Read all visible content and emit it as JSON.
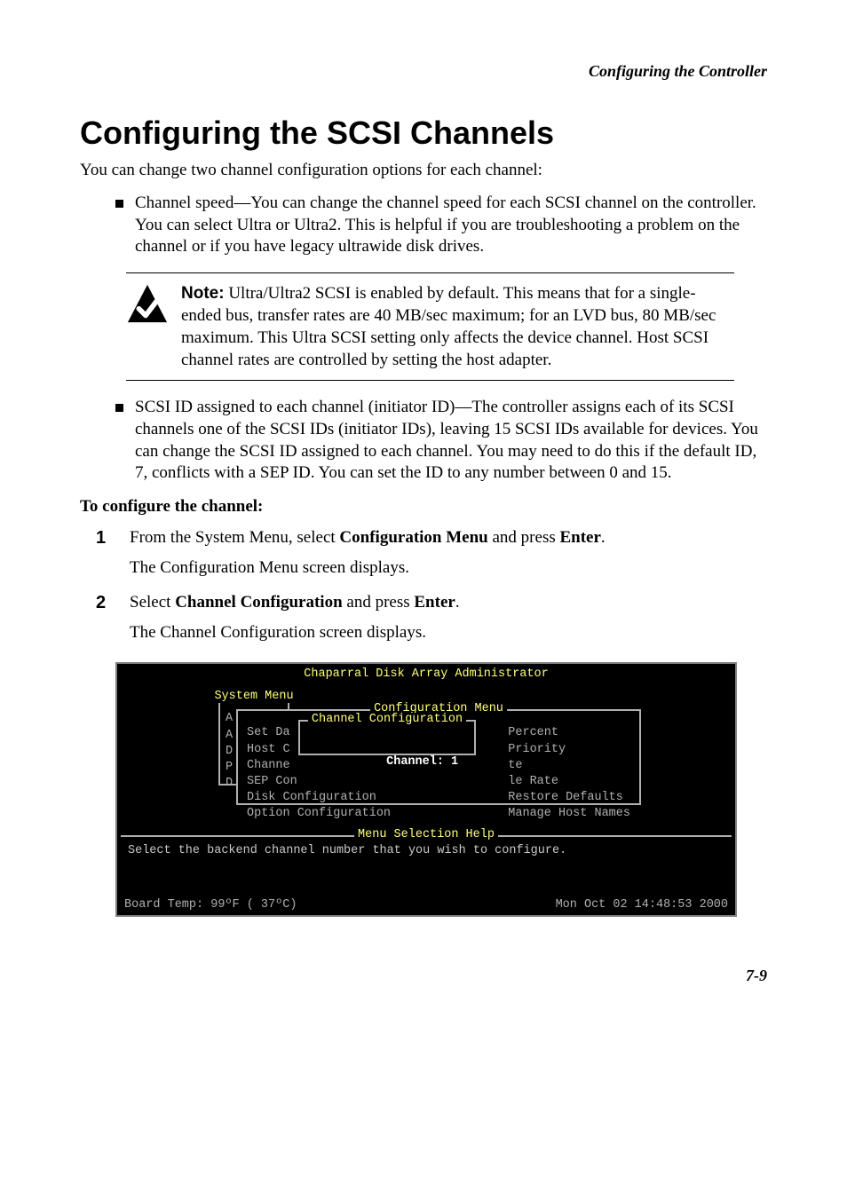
{
  "header": {
    "section_title": "Configuring the Controller"
  },
  "title": "Configuring the SCSI Channels",
  "intro": "You can change two channel configuration options for each channel:",
  "bullets": {
    "b1": "Channel speed—You can change the channel speed for each SCSI channel on the controller. You can select Ultra or Ultra2. This is helpful if you are troubleshooting a problem on the channel or if you have legacy ultrawide disk drives.",
    "b2": "SCSI ID assigned to each channel (initiator ID)—The controller assigns each of its SCSI channels one of the SCSI IDs (initiator IDs), leaving 15 SCSI IDs available for devices. You can change the SCSI ID assigned to each channel. You may need to do this if the default ID, 7, conflicts with a SEP ID. You can set the ID to any number between 0 and 15."
  },
  "note": {
    "label": "Note:",
    "text": " Ultra/Ultra2 SCSI is enabled by default. This means that for a single-ended bus, transfer rates are 40 MB/sec maximum; for an LVD bus, 80 MB/sec maximum. This Ultra SCSI setting only affects the device channel. Host SCSI channel rates are controlled by setting the host adapter."
  },
  "subhead": "To configure the channel:",
  "steps": {
    "s1": {
      "pre": "From the System Menu, select ",
      "bold1": "Configuration Menu",
      "mid": " and press ",
      "bold2": "Enter",
      "post": ".",
      "after": "The Configuration Menu screen displays."
    },
    "s2": {
      "pre": "Select ",
      "bold1": "Channel Configuration",
      "mid": " and press ",
      "bold2": "Enter",
      "post": ".",
      "after": "The Channel Configuration screen displays."
    }
  },
  "terminal": {
    "top_title": "Chaparral Disk Array Administrator",
    "sysmenu_title": "System Menu",
    "sysmenu_letters": "A\nA\nD\nP\nD",
    "confmenu_title": "Configuration Menu",
    "conf_left": "Set Da\nHost C\nChanne\nSEP Con\nDisk Configuration\nOption Configuration",
    "conf_right": "Percent\nPriority\nte\nle Rate\nRestore Defaults\nManage Host Names",
    "chan_title": "Channel Configuration",
    "chan_highlight": " Channel: 1",
    "help_title": "Menu Selection Help",
    "help_text": "Select the backend channel number that you wish to configure.",
    "status_left": "Board Temp:  99ºF ( 37ºC)",
    "status_right": "Mon Oct 02 14:48:53 2000"
  },
  "page_num": "7-9"
}
